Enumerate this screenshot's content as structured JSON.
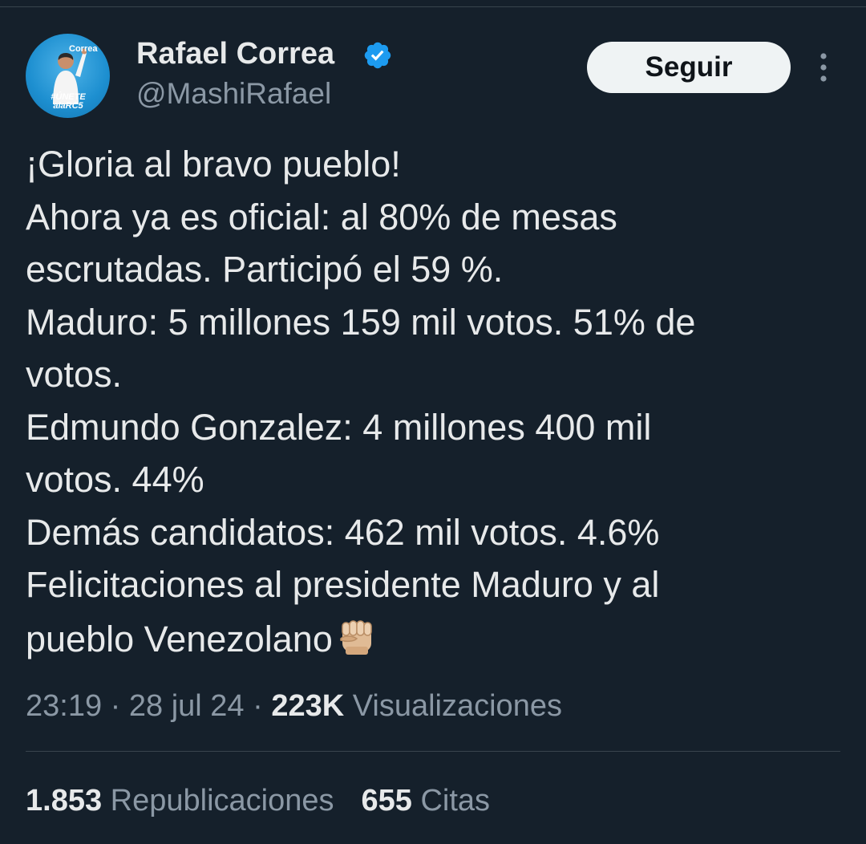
{
  "author": {
    "display_name": "Rafael Correa",
    "handle": "@MashiRafael",
    "avatar_logo_text": "Correa",
    "avatar_tag_text": "#ÚNETE alaRC5"
  },
  "follow_button": {
    "label": "Seguir"
  },
  "icons": {
    "verified": "verified-badge-icon",
    "more": "more-options-icon",
    "emoji": "raised-fist-emoji"
  },
  "colors": {
    "background": "#15202b",
    "verified_blue": "#1d9bf0",
    "text_primary": "#e7e9ea",
    "text_secondary": "#8b98a5"
  },
  "tweet": {
    "lines": [
      "¡Gloria al bravo pueblo!",
      "Ahora ya es oficial: al 80% de mesas",
      "escrutadas. Participó el 59 %.",
      "Maduro: 5 millones 159 mil votos. 51% de",
      "votos.",
      "Edmundo Gonzalez: 4 millones 400 mil",
      "votos. 44%",
      "Demás candidatos: 462 mil votos. 4.6%",
      "Felicitaciones al presidente Maduro y al",
      "pueblo Venezolano"
    ]
  },
  "meta": {
    "time": "23:19",
    "sep1": " · ",
    "date": "28 jul 24",
    "sep2": " · ",
    "views_count": "223K",
    "views_label": " Visualizaciones"
  },
  "stats": {
    "reposts_count": "1.853",
    "reposts_label": " Republicaciones",
    "quotes_count": "655",
    "quotes_label": " Citas"
  }
}
